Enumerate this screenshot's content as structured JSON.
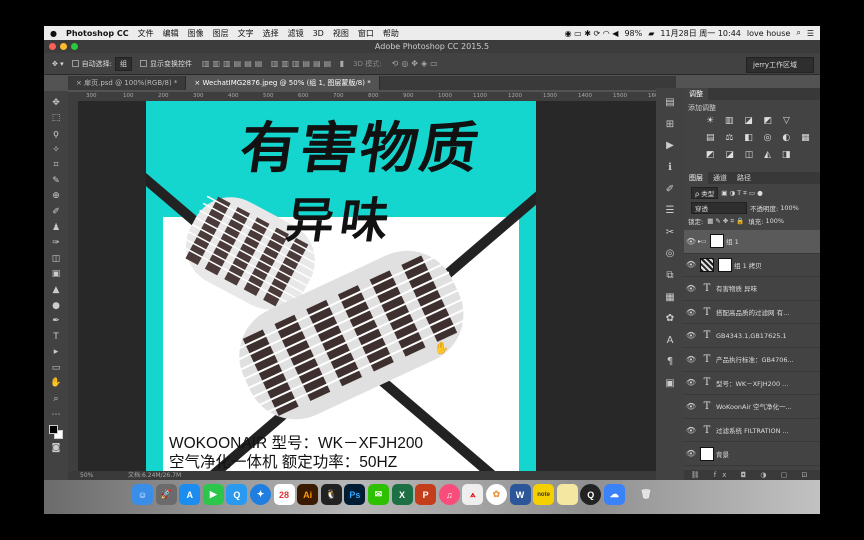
{
  "menubar": {
    "apple": "",
    "app": "Photoshop CC",
    "items": [
      "文件",
      "编辑",
      "图像",
      "图层",
      "文字",
      "选择",
      "滤镜",
      "3D",
      "视图",
      "窗口",
      "帮助"
    ],
    "battery": "98%",
    "datetime": "11月28日 周一 10:44",
    "user": "love house"
  },
  "window": {
    "title": "Adobe Photoshop CC 2015.5"
  },
  "options": {
    "auto_select_label": "自动选择:",
    "auto_select_value": "组",
    "show_transform_label": "显示变换控件",
    "mode_3d": "3D 模式:",
    "workspace": "jerry工作区域"
  },
  "tabs": [
    {
      "label": "× 扉页.psd @ 100%(RGB/8) *"
    },
    {
      "label": "× WechatIMG2876.jpeg @ 50% (组 1, 图层蒙版/8) *"
    }
  ],
  "ruler_ticks": [
    "300",
    "100",
    "200",
    "300",
    "400",
    "500",
    "600",
    "700",
    "800",
    "900",
    "1000",
    "1100",
    "1200",
    "1300",
    "1400",
    "1500",
    "1600"
  ],
  "document": {
    "title_line1": "有害物质",
    "title_line2": "异味",
    "product_line1": "WOKOONAIR    型号：WK－XFJH200",
    "product_line2": "空气净化一体机  额定功率：50HZ",
    "bg_color": "#15d6cf"
  },
  "status": {
    "zoom": "50%",
    "file": "文档:6.24M/26.7M"
  },
  "adjustments": {
    "tabs": [
      "调整"
    ],
    "add_label": "添加调整",
    "row1": "☀ ▥ ◪ ◩ ▽",
    "row2": "▤ ⚖ ◧ ◎ ◐ ▦",
    "row3": "◩ ◪ ◫ ◭ ◨"
  },
  "layers_panel": {
    "tabs": [
      "图层",
      "通道",
      "路径"
    ],
    "kind_label": "ρ 类型",
    "blend_mode": "穿透",
    "opacity_label": "不透明度:",
    "opacity_value": "100%",
    "lock_label": "锁定:",
    "fill_label": "填充:",
    "fill_value": "100%",
    "layers": [
      {
        "name": "组 1",
        "type": "group"
      },
      {
        "name": "组 1 拷贝",
        "type": "image"
      },
      {
        "name": "有害物质 异味",
        "type": "text"
      },
      {
        "name": "搭配高品质的过滤网 有...",
        "type": "text"
      },
      {
        "name": "GB4343.1,GB17625.1",
        "type": "text"
      },
      {
        "name": "产品执行标准：GB4706...",
        "type": "text"
      },
      {
        "name": "型号：WK－XFJH200 ...",
        "type": "text"
      },
      {
        "name": "WoKoonAir 空气净化一...",
        "type": "text"
      },
      {
        "name": "过滤系统 FILTRATION ...",
        "type": "text"
      },
      {
        "name": "背景",
        "type": "image"
      }
    ],
    "footer": "⛓ fx ◘ ◑ ▢ ⊡ 🗑"
  },
  "tools": [
    "move",
    "marquee",
    "lasso",
    "magic-wand",
    "crop",
    "eyedropper",
    "healing",
    "brush",
    "stamp",
    "history-brush",
    "eraser",
    "gradient",
    "blur",
    "dodge",
    "pen",
    "type",
    "path-select",
    "shape",
    "hand",
    "zoom",
    "more"
  ],
  "dock": [
    "Finder",
    "Launchpad",
    "App Store",
    "FaceTime",
    "QQ Browser",
    "Safari",
    "Calendar",
    "Illustrator",
    "QQ",
    "Photoshop",
    "WeChat",
    "Excel",
    "PowerPoint",
    "iTunes",
    "Acrobat",
    "Photos",
    "Word",
    "Stickies",
    "Notes",
    "QuickTime",
    "Baidu Netdisk",
    "Trash"
  ]
}
